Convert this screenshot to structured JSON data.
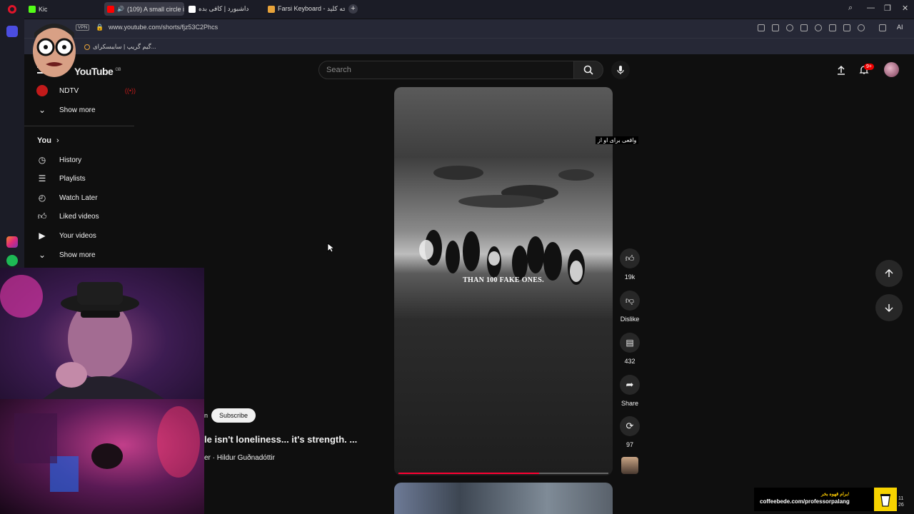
{
  "browser": {
    "tabs": [
      {
        "label": "Kic",
        "favicon_color": "#53fc18"
      },
      {
        "label": "(109) A small circle is...",
        "favicon_color": "#ff0000",
        "active": true
      },
      {
        "label": "داشبورد | کافی بده",
        "favicon_color": "#ffffff"
      },
      {
        "label": "Farsi Keyboard - صفحه کلید",
        "favicon_color": "#e8a33a"
      }
    ],
    "new_tab": "+",
    "vpn": "VPN",
    "url": "www.youtube.com/shorts/fjz53C2Phcs",
    "bookmark": "گیم گریپ | سایبسکرای...",
    "ai_label": "AI"
  },
  "youtube": {
    "logo": "YouTube",
    "region": "GB",
    "search_placeholder": "Search",
    "notification_badge": "9+",
    "sidebar": {
      "subscription": "NDTV",
      "show_more_1": "Show more",
      "you": "You",
      "items": [
        "History",
        "Playlists",
        "Watch Later",
        "Liked videos",
        "Your videos"
      ],
      "show_more_2": "Show more"
    },
    "short": {
      "caption": "THAN 100 FAKE ONES.",
      "overlay_text": "واقعی برای او از",
      "progress": 0.67,
      "subscribe": "Subscribe",
      "channel_fragment": "n",
      "title": "le isn't loneliness... it's strength. ...",
      "audio": "er · Hildur Guðnadóttir"
    },
    "actions": {
      "likes": "19k",
      "dislike": "Dislike",
      "comments": "432",
      "share": "Share",
      "remix": "97"
    }
  },
  "overlay": {
    "coffee_small": "برام قهوه بخر!",
    "coffee_url": "coffeebede.com/professorpalang",
    "clock_line1": "11",
    "clock_line2": "26"
  }
}
